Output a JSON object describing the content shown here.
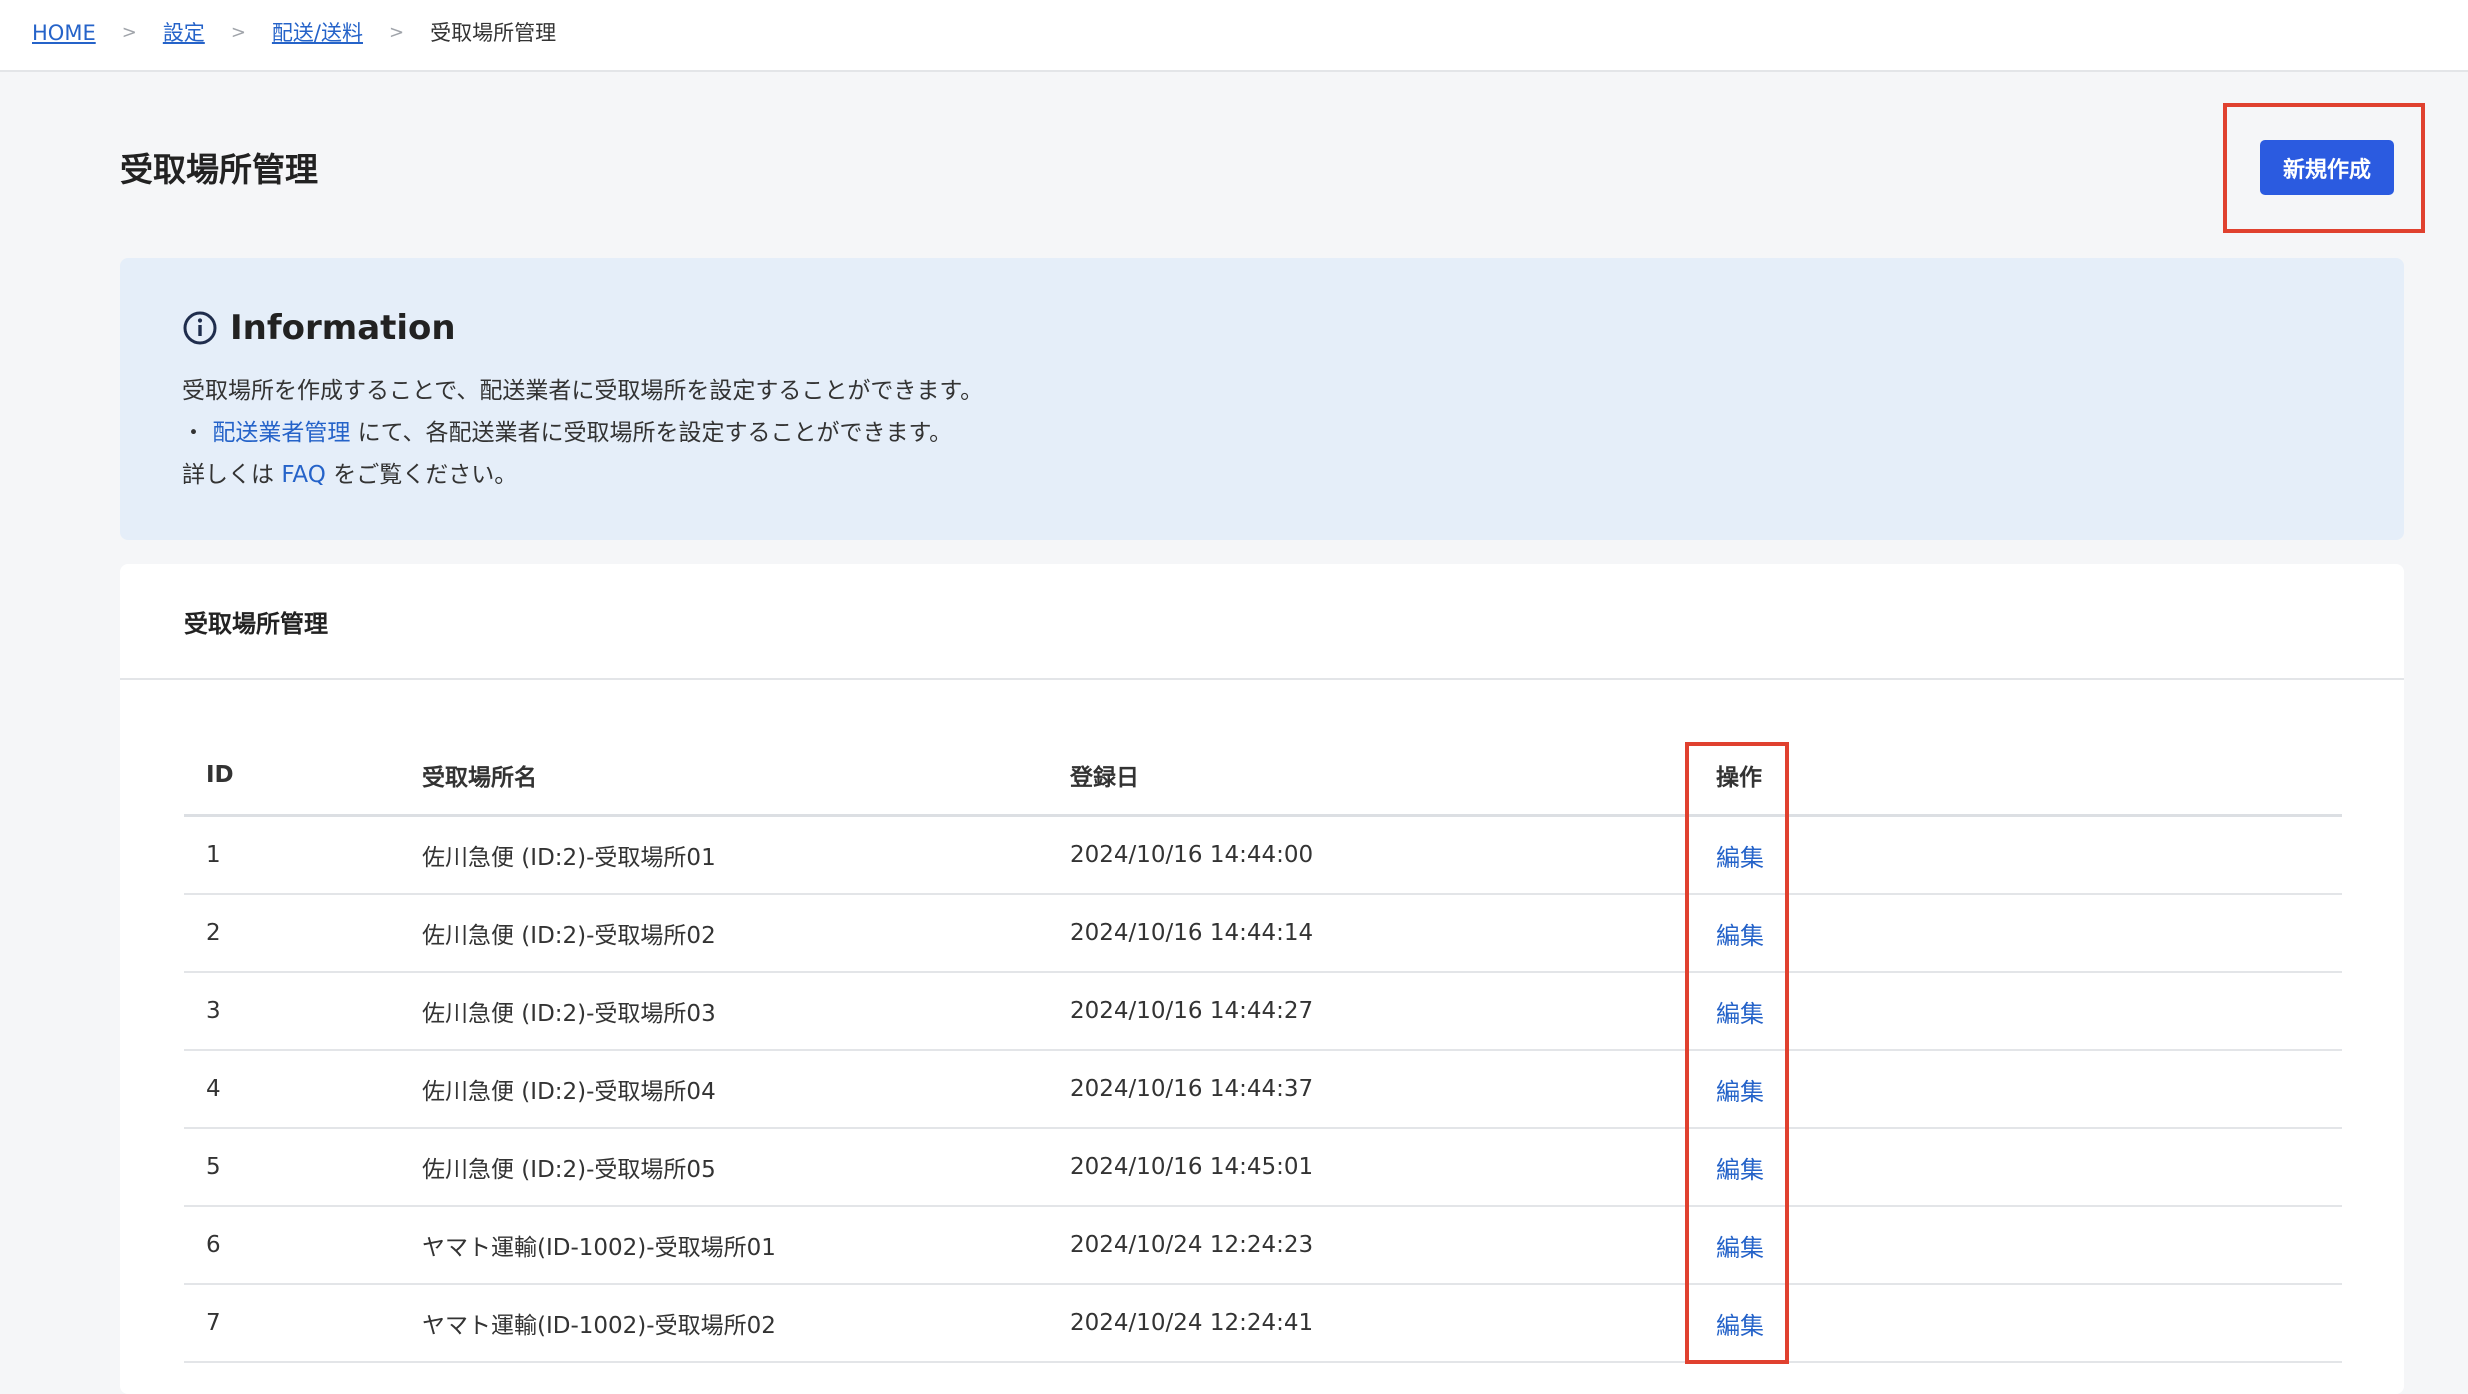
{
  "breadcrumb": {
    "items": [
      "HOME",
      "設定",
      "配送/送料"
    ],
    "separator": ">",
    "current": "受取場所管理"
  },
  "page": {
    "title": "受取場所管理",
    "create_button": "新規作成"
  },
  "info": {
    "title": "Information",
    "line1": "受取場所を作成することで、配送業者に受取場所を設定することができます。",
    "line2_prefix": "・",
    "line2_link": "配送業者管理",
    "line2_suffix": "にて、各配送業者に受取場所を設定することができます。",
    "line3_prefix": "詳しくは",
    "line3_link": "FAQ",
    "line3_suffix": "をご覧ください。"
  },
  "card": {
    "title": "受取場所管理"
  },
  "table": {
    "headers": {
      "id": "ID",
      "name": "受取場所名",
      "date": "登録日",
      "action": "操作"
    },
    "rows": [
      {
        "id": "1",
        "name": "佐川急便 (ID:2)-受取場所01",
        "date": "2024/10/16 14:44:00",
        "action": "編集"
      },
      {
        "id": "2",
        "name": "佐川急便 (ID:2)-受取場所02",
        "date": "2024/10/16 14:44:14",
        "action": "編集"
      },
      {
        "id": "3",
        "name": "佐川急便 (ID:2)-受取場所03",
        "date": "2024/10/16 14:44:27",
        "action": "編集"
      },
      {
        "id": "4",
        "name": "佐川急便 (ID:2)-受取場所04",
        "date": "2024/10/16 14:44:37",
        "action": "編集"
      },
      {
        "id": "5",
        "name": "佐川急便 (ID:2)-受取場所05",
        "date": "2024/10/16 14:45:01",
        "action": "編集"
      },
      {
        "id": "6",
        "name": "ヤマト運輸(ID-1002)-受取場所01",
        "date": "2024/10/24 12:24:23",
        "action": "編集"
      },
      {
        "id": "7",
        "name": "ヤマト運輸(ID-1002)-受取場所02",
        "date": "2024/10/24 12:24:41",
        "action": "編集"
      }
    ]
  },
  "colors": {
    "accent": "#2b5be0",
    "link": "#2563c9",
    "highlight": "#e0412f",
    "info_bg": "#e5eef9"
  },
  "icons": {
    "info": "info-circle-icon"
  }
}
